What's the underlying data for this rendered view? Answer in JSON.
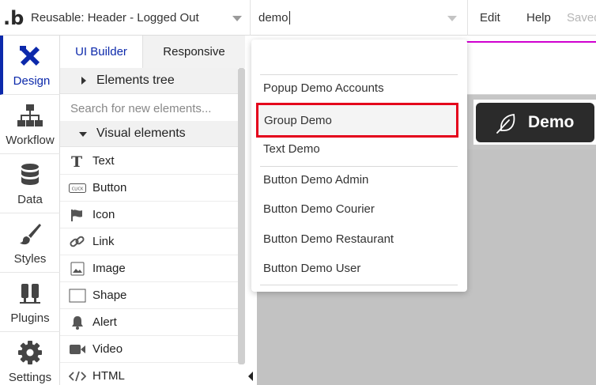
{
  "app": {
    "logo_text": ".b"
  },
  "header": {
    "page_select": "Reusable: Header - Logged Out",
    "search_value": "demo",
    "menu": [
      "Edit",
      "Help",
      "Saved"
    ]
  },
  "rail": {
    "items": [
      {
        "label": "Design",
        "icon": "design-icon",
        "active": true
      },
      {
        "label": "Workflow",
        "icon": "workflow-icon"
      },
      {
        "label": "Data",
        "icon": "database-icon"
      },
      {
        "label": "Styles",
        "icon": "brush-icon"
      },
      {
        "label": "Plugins",
        "icon": "plug-icon"
      },
      {
        "label": "Settings",
        "icon": "gear-icon"
      }
    ],
    "active_color": "#0c29ab"
  },
  "panel": {
    "tabs": [
      "UI Builder",
      "Responsive"
    ],
    "elements_tree": "Elements tree",
    "search_placeholder": "Search for new elements...",
    "visual_elements": "Visual elements",
    "elements": [
      {
        "label": "Text",
        "icon": "text-icon"
      },
      {
        "label": "Button",
        "icon": "button-icon",
        "icon_text": "CLICK"
      },
      {
        "label": "Icon",
        "icon": "flag-icon"
      },
      {
        "label": "Link",
        "icon": "link-icon"
      },
      {
        "label": "Image",
        "icon": "image-icon"
      },
      {
        "label": "Shape",
        "icon": "shape-icon"
      },
      {
        "label": "Alert",
        "icon": "bell-icon"
      },
      {
        "label": "Video",
        "icon": "video-icon"
      },
      {
        "label": "HTML",
        "icon": "code-icon"
      }
    ]
  },
  "dropdown": {
    "items": [
      "Popup Demo Accounts",
      "Group Demo",
      "Text Demo",
      "Button Demo Admin",
      "Button Demo Courier",
      "Button Demo Restaurant",
      "Button Demo User"
    ],
    "highlighted": "Group Demo",
    "highlight_color": "#e4001b"
  },
  "canvas": {
    "button_label": "Demo",
    "button_icon": "feather-icon"
  }
}
